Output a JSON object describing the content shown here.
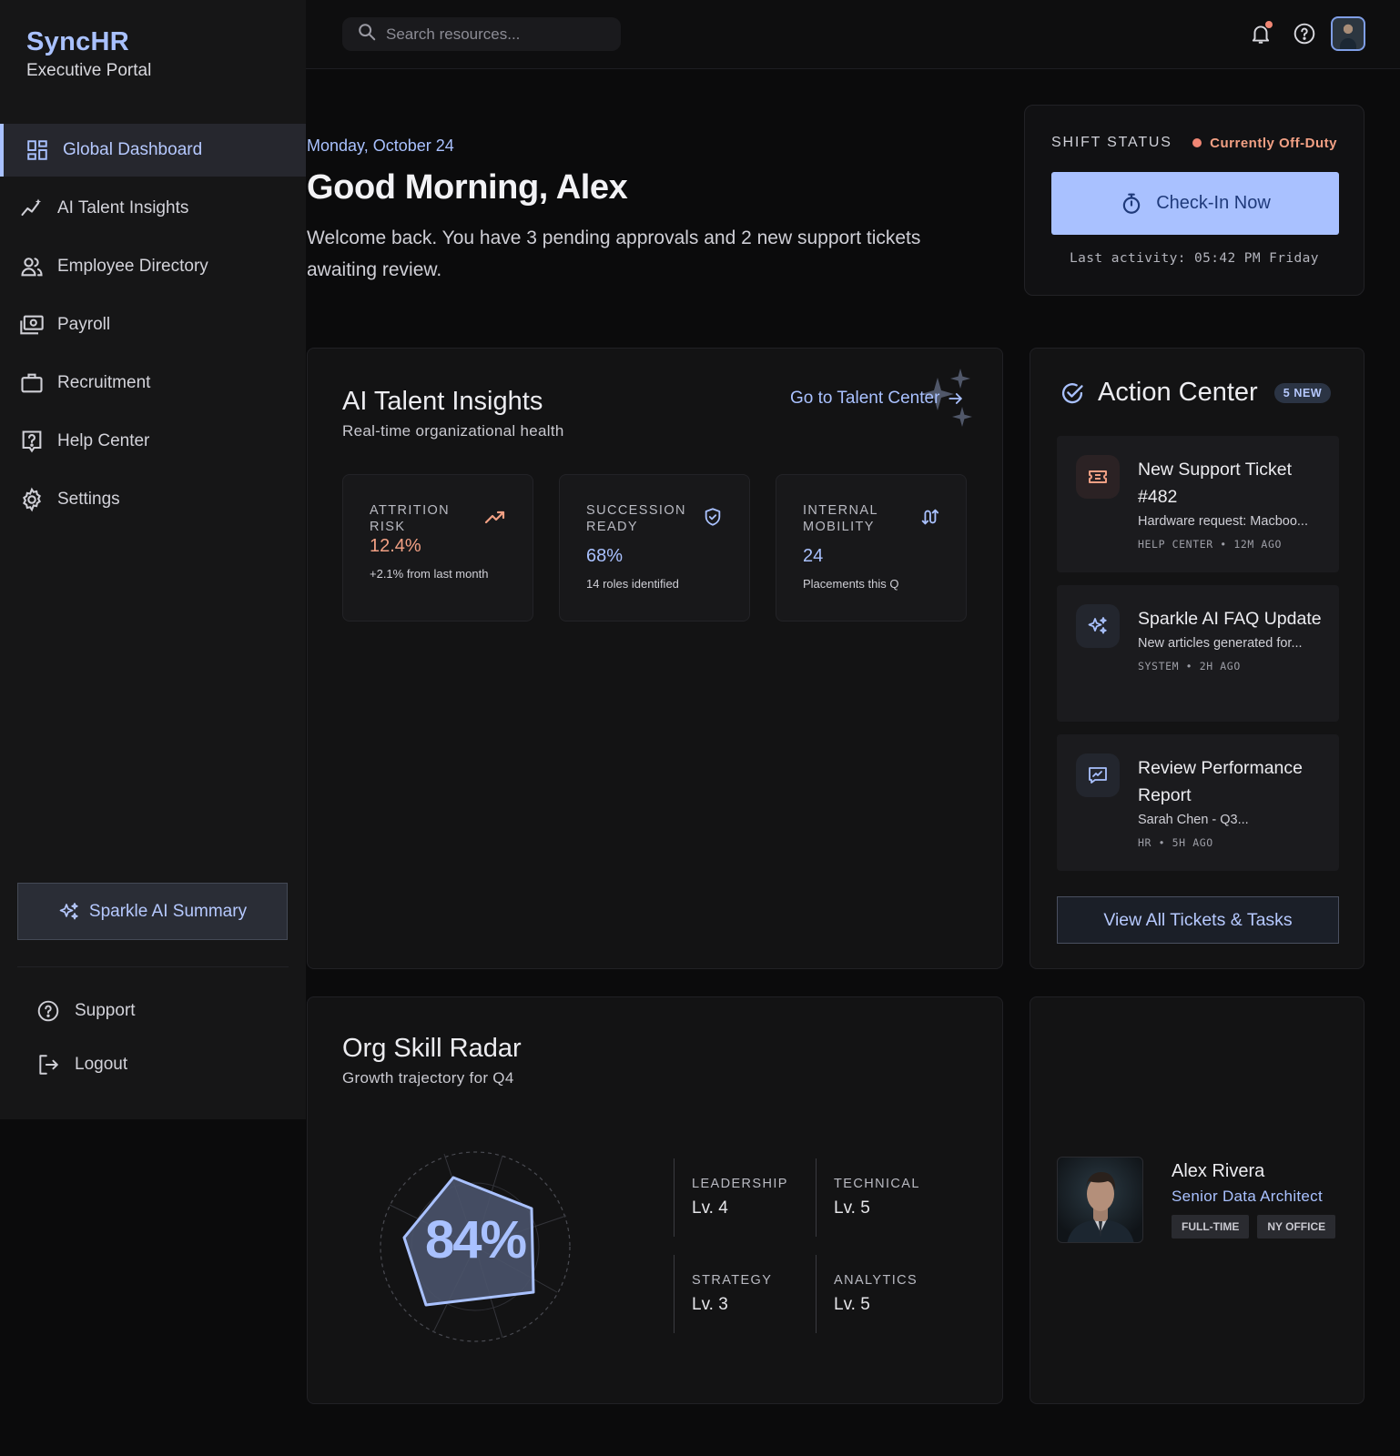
{
  "brand": {
    "name": "SyncHR",
    "subtitle": "Executive Portal"
  },
  "sidebar": {
    "items": [
      {
        "label": "Global Dashboard",
        "icon": "dashboard-icon",
        "active": true
      },
      {
        "label": "AI Talent Insights",
        "icon": "insights-icon"
      },
      {
        "label": "Employee Directory",
        "icon": "people-icon"
      },
      {
        "label": "Payroll",
        "icon": "payroll-icon"
      },
      {
        "label": "Recruitment",
        "icon": "briefcase-icon"
      },
      {
        "label": "Help Center",
        "icon": "help-center-icon"
      },
      {
        "label": "Settings",
        "icon": "gear-icon"
      }
    ],
    "sparkle_button": "Sparkle AI Summary",
    "support": "Support",
    "logout": "Logout"
  },
  "topbar": {
    "search_placeholder": "Search resources..."
  },
  "hero": {
    "date": "Monday, October 24",
    "greeting": "Good Morning, Alex",
    "message": "Welcome back. You have 3 pending approvals and 2 new support tickets awaiting review."
  },
  "shift": {
    "label": "SHIFT STATUS",
    "status": "Currently Off-Duty",
    "button": "Check-In Now",
    "last_activity": "Last activity: 05:42 PM Friday"
  },
  "insights": {
    "title": "AI Talent Insights",
    "subtitle": "Real-time organizational health",
    "link": "Go to Talent Center",
    "metrics": [
      {
        "label": "ATTRITION RISK",
        "value": "12.4%",
        "note": "+2.1% from last month",
        "color": "#f2a084"
      },
      {
        "label": "SUCCESSION READY",
        "value": "68%",
        "note": "14 roles identified",
        "color": "#a9c1ff"
      },
      {
        "label": "INTERNAL MOBILITY",
        "value": "24",
        "note": "Placements this Q",
        "color": "#a9c1ff"
      }
    ]
  },
  "action_center": {
    "title": "Action Center",
    "badge": "5 NEW",
    "tasks": [
      {
        "title": "New Support Ticket #482",
        "desc": "Hardware request: Macboo...",
        "meta": "HELP CENTER • 12M AGO",
        "icon": "ticket-icon"
      },
      {
        "title": "Sparkle AI FAQ Update",
        "desc": "New articles generated for...",
        "meta": "SYSTEM • 2H AGO",
        "icon": "sparkle-icon"
      },
      {
        "title": "Review Performance Report",
        "desc": "Sarah Chen - Q3...",
        "meta": "HR • 5H AGO",
        "icon": "report-icon"
      }
    ],
    "view_all": "View All Tickets & Tasks"
  },
  "radar": {
    "title": "Org Skill Radar",
    "subtitle": "Growth trajectory for Q4",
    "value": "84%",
    "skills": [
      {
        "label": "LEADERSHIP",
        "level": "Lv. 4"
      },
      {
        "label": "TECHNICAL",
        "level": "Lv. 5"
      },
      {
        "label": "STRATEGY",
        "level": "Lv. 3"
      },
      {
        "label": "ANALYTICS",
        "level": "Lv. 5"
      }
    ]
  },
  "profile": {
    "name": "Alex Rivera",
    "role": "Senior Data Architect",
    "tags": [
      "FULL-TIME",
      "NY OFFICE"
    ]
  }
}
